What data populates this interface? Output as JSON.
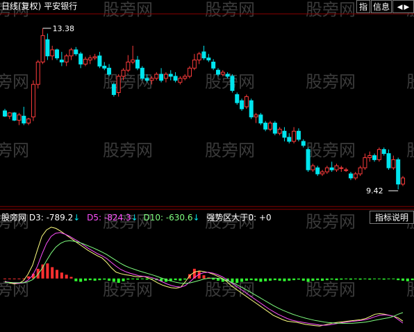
{
  "top_header": {
    "period_label": "日线(复权)",
    "stock_name": "平安银行"
  },
  "toolbar": {
    "indicator_button": "指",
    "info_button": "信息",
    "prev_icon": "arrow-left-icon",
    "next_icon": "arrow-right-icon"
  },
  "watermark": "股旁网",
  "indicator_header": {
    "source": "股旁网",
    "d3": "D3: -789.2",
    "d5": "D5: -824.3",
    "d10": "D10: -630.6",
    "strong_zone": "强势区大于0: +0",
    "explain_button": "指标说明"
  },
  "colors": {
    "up": "#ff3c3c",
    "down": "#00e5ee",
    "d3": "#ffff80",
    "d5": "#ff50ff",
    "d10": "#80ff80",
    "bar_pos": "#ff3030",
    "bar_neg": "#30ff30",
    "grid": "#8b0000"
  },
  "chart_data": [
    {
      "type": "candlestick",
      "max_label": "13.38",
      "min_label": "9.42",
      "ylim": [
        9.1,
        13.7
      ],
      "ohlc": [
        [
          11.35,
          11.4,
          11.2,
          11.22
        ],
        [
          11.22,
          11.32,
          11.15,
          11.3
        ],
        [
          11.3,
          11.32,
          11.1,
          11.12
        ],
        [
          11.12,
          11.3,
          11.0,
          11.25
        ],
        [
          11.22,
          11.45,
          11.0,
          11.05
        ],
        [
          11.05,
          11.18,
          11.0,
          11.15
        ],
        [
          11.2,
          12.1,
          11.1,
          12.0
        ],
        [
          12.0,
          12.6,
          11.9,
          12.55
        ],
        [
          12.55,
          13.38,
          12.5,
          13.2
        ],
        [
          13.1,
          13.25,
          12.6,
          12.7
        ],
        [
          12.7,
          12.95,
          12.6,
          12.85
        ],
        [
          12.85,
          12.88,
          12.6,
          12.65
        ],
        [
          12.6,
          12.8,
          12.45,
          12.55
        ],
        [
          12.55,
          12.75,
          12.45,
          12.7
        ],
        [
          12.7,
          12.9,
          12.6,
          12.85
        ],
        [
          12.85,
          12.92,
          12.7,
          12.75
        ],
        [
          12.75,
          12.8,
          12.4,
          12.5
        ],
        [
          12.5,
          12.68,
          12.45,
          12.62
        ],
        [
          12.6,
          12.72,
          12.5,
          12.65
        ],
        [
          12.65,
          12.75,
          12.6,
          12.68
        ],
        [
          12.7,
          12.8,
          12.4,
          12.45
        ],
        [
          12.45,
          12.55,
          12.35,
          12.4
        ],
        [
          12.4,
          12.5,
          12.2,
          12.25
        ],
        [
          12.0,
          12.05,
          11.7,
          11.75
        ],
        [
          11.8,
          12.25,
          11.7,
          12.2
        ],
        [
          12.2,
          12.4,
          12.1,
          12.35
        ],
        [
          12.35,
          12.72,
          12.3,
          12.55
        ],
        [
          12.55,
          12.95,
          12.5,
          12.6
        ],
        [
          12.6,
          12.7,
          12.35,
          12.4
        ],
        [
          12.4,
          12.45,
          12.1,
          12.15
        ],
        [
          12.15,
          12.25,
          12.05,
          12.1
        ],
        [
          12.1,
          12.2,
          12.0,
          12.15
        ],
        [
          12.15,
          12.3,
          12.1,
          12.25
        ],
        [
          12.25,
          12.4,
          12.05,
          12.1
        ],
        [
          12.15,
          12.3,
          12.05,
          12.25
        ],
        [
          12.25,
          12.35,
          12.1,
          12.2
        ],
        [
          12.2,
          12.3,
          12.05,
          12.1
        ],
        [
          12.05,
          12.2,
          12.0,
          12.15
        ],
        [
          12.15,
          12.25,
          12.1,
          12.2
        ],
        [
          12.2,
          12.45,
          12.15,
          12.4
        ],
        [
          12.4,
          12.75,
          12.35,
          12.6
        ],
        [
          12.6,
          12.8,
          12.5,
          12.75
        ],
        [
          12.8,
          12.95,
          12.6,
          12.65
        ],
        [
          12.65,
          12.75,
          12.55,
          12.6
        ],
        [
          12.55,
          12.62,
          12.35,
          12.4
        ],
        [
          12.35,
          12.4,
          12.2,
          12.25
        ],
        [
          12.25,
          12.35,
          12.2,
          12.3
        ],
        [
          12.25,
          12.3,
          12.15,
          12.2
        ],
        [
          12.2,
          12.25,
          11.8,
          11.85
        ],
        [
          11.75,
          11.8,
          11.5,
          11.55
        ],
        [
          11.6,
          11.65,
          11.35,
          11.4
        ],
        [
          11.45,
          11.75,
          11.4,
          11.7
        ],
        [
          11.6,
          11.65,
          11.15,
          11.2
        ],
        [
          11.2,
          11.3,
          11.05,
          11.25
        ],
        [
          11.25,
          11.3,
          11.0,
          11.05
        ],
        [
          11.05,
          11.1,
          10.85,
          10.9
        ],
        [
          10.9,
          11.1,
          10.85,
          11.05
        ],
        [
          11.05,
          11.1,
          10.75,
          10.8
        ],
        [
          10.8,
          10.95,
          10.75,
          10.9
        ],
        [
          10.85,
          10.95,
          10.6,
          10.7
        ],
        [
          10.7,
          10.8,
          10.55,
          10.6
        ],
        [
          10.6,
          10.95,
          10.55,
          10.85
        ],
        [
          10.85,
          10.92,
          10.6,
          10.65
        ],
        [
          10.6,
          10.65,
          10.45,
          10.5
        ],
        [
          10.4,
          10.45,
          9.85,
          9.9
        ],
        [
          9.9,
          10.05,
          9.85,
          10.0
        ],
        [
          9.95,
          10.0,
          9.75,
          9.8
        ],
        [
          9.8,
          9.9,
          9.75,
          9.85
        ],
        [
          9.85,
          10.0,
          9.8,
          9.95
        ],
        [
          9.95,
          10.1,
          9.85,
          9.9
        ],
        [
          9.9,
          10.05,
          9.85,
          10.0
        ],
        [
          9.95,
          10.0,
          9.85,
          9.95
        ],
        [
          9.9,
          9.95,
          9.85,
          9.9
        ],
        [
          9.8,
          9.85,
          9.65,
          9.7
        ],
        [
          9.7,
          9.85,
          9.65,
          9.8
        ],
        [
          9.8,
          10.0,
          9.75,
          9.95
        ],
        [
          9.95,
          10.3,
          9.9,
          10.2
        ],
        [
          10.2,
          10.35,
          10.1,
          10.25
        ],
        [
          10.25,
          10.3,
          10.1,
          10.15
        ],
        [
          10.15,
          10.45,
          10.1,
          10.4
        ],
        [
          10.4,
          10.45,
          10.25,
          10.3
        ],
        [
          10.3,
          10.4,
          9.9,
          9.95
        ],
        [
          9.95,
          10.25,
          9.9,
          10.15
        ],
        [
          10.15,
          10.2,
          9.42,
          9.55
        ],
        [
          9.55,
          9.75,
          9.5,
          9.7
        ]
      ]
    },
    {
      "type": "line+bar",
      "series": [
        {
          "name": "D3",
          "values": [
            -50,
            -80,
            -100,
            -90,
            -40,
            80,
            250,
            520,
            780,
            900,
            950,
            930,
            880,
            820,
            760,
            700,
            640,
            580,
            520,
            470,
            420,
            380,
            300,
            200,
            120,
            90,
            70,
            60,
            40,
            30,
            40,
            10,
            -30,
            -80,
            -120,
            -150,
            -170,
            -180,
            -160,
            -60,
            60,
            120,
            140,
            130,
            110,
            80,
            40,
            0,
            -60,
            -140,
            -200,
            -260,
            -320,
            -380,
            -440,
            -500,
            -560,
            -620,
            -680,
            -720,
            -760,
            -790,
            -800,
            -810,
            -830,
            -850,
            -860,
            -870,
            -880,
            -860,
            -840,
            -820,
            -810,
            -800,
            -790,
            -780,
            -770,
            -760,
            -740,
            -700,
            -660,
            -650,
            -660,
            -680,
            -700,
            -730,
            -789
          ]
        },
        {
          "name": "D5",
          "values": [
            -60,
            -70,
            -85,
            -90,
            -80,
            -30,
            60,
            220,
            450,
            650,
            780,
            840,
            850,
            820,
            780,
            730,
            680,
            620,
            560,
            510,
            460,
            420,
            370,
            300,
            230,
            170,
            130,
            100,
            75,
            50,
            40,
            30,
            10,
            -20,
            -60,
            -100,
            -130,
            -150,
            -160,
            -130,
            -60,
            20,
            80,
            110,
            115,
            100,
            70,
            30,
            -20,
            -80,
            -140,
            -200,
            -260,
            -320,
            -380,
            -440,
            -500,
            -560,
            -610,
            -660,
            -700,
            -740,
            -770,
            -790,
            -805,
            -820,
            -835,
            -848,
            -860,
            -865,
            -860,
            -845,
            -830,
            -815,
            -805,
            -795,
            -785,
            -775,
            -760,
            -735,
            -705,
            -680,
            -670,
            -680,
            -700,
            -760,
            -824
          ]
        },
        {
          "name": "D10",
          "values": [
            -70,
            -72,
            -75,
            -78,
            -78,
            -60,
            -20,
            60,
            180,
            330,
            470,
            580,
            650,
            690,
            700,
            690,
            670,
            640,
            605,
            570,
            530,
            490,
            445,
            390,
            335,
            280,
            235,
            200,
            170,
            140,
            115,
            90,
            65,
            35,
            5,
            -25,
            -50,
            -70,
            -85,
            -90,
            -80,
            -60,
            -35,
            -10,
            5,
            10,
            5,
            -10,
            -35,
            -70,
            -110,
            -155,
            -200,
            -250,
            -300,
            -350,
            -400,
            -450,
            -500,
            -545,
            -585,
            -620,
            -655,
            -685,
            -710,
            -735,
            -755,
            -775,
            -790,
            -805,
            -815,
            -822,
            -828,
            -830,
            -830,
            -828,
            -822,
            -815,
            -805,
            -790,
            -772,
            -755,
            -740,
            -725,
            -700,
            -660,
            -630
          ]
        },
        {
          "name": "bars",
          "values": [
            0,
            0,
            0,
            0,
            0,
            40,
            90,
            180,
            260,
            280,
            210,
            160,
            110,
            70,
            30,
            -50,
            -60,
            -40,
            -30,
            -40,
            -30,
            -20,
            -40,
            -60,
            -80,
            -50,
            -20,
            -10,
            -20,
            -10,
            -20,
            -10,
            -30,
            -50,
            -60,
            -40,
            -30,
            -40,
            -20,
            80,
            180,
            140,
            60,
            20,
            -20,
            -40,
            -60,
            -50,
            -70,
            -80,
            -60,
            -40,
            -30,
            -40,
            -60,
            -50,
            -40,
            -30,
            -40,
            -50,
            -40,
            -30,
            -20,
            -40,
            -60,
            -40,
            -30,
            -40,
            -30,
            -20,
            -30,
            -20,
            -10,
            -20,
            -10,
            -20,
            -10,
            -20,
            -10,
            -10,
            -20,
            -10,
            -10,
            -30,
            -40,
            -50,
            -30
          ]
        }
      ],
      "ylim": [
        -900,
        1050
      ],
      "zero_line": 0
    }
  ]
}
